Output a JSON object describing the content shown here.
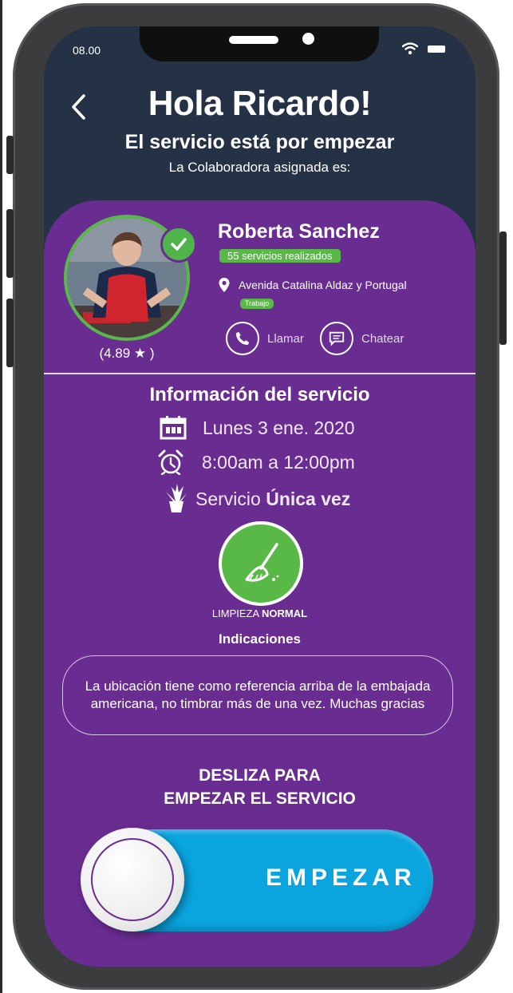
{
  "status_bar": {
    "time": "08.00"
  },
  "header": {
    "greeting": "Hola Ricardo!",
    "subtitle": "El servicio está por empezar",
    "assigned_text": "La Colaboradora asignada es:"
  },
  "collaborator": {
    "name": "Roberta Sanchez",
    "services_badge": "55 servicios realizados",
    "address": "Avenida Catalina Aldaz y Portugal",
    "address_tag": "Trabajo",
    "rating": "(4.89 ★ )",
    "call_label": "Llamar",
    "chat_label": "Chatear"
  },
  "service": {
    "section_title": "Información del servicio",
    "date": "Lunes 3 ene. 2020",
    "time": "8:00am a 12:00pm",
    "type_prefix": "Servicio ",
    "type_value": "Única vez",
    "cleaning_prefix": "LIMPIEZA ",
    "cleaning_value": "NORMAL",
    "indications_title": "Indicaciones",
    "indications_text": "La ubicación tiene como referencia arriba de la embajada americana, no timbrar más de una vez. Muchas gracias"
  },
  "slider": {
    "hint_line1": "DESLIZA PARA",
    "hint_line2": "EMPEZAR EL SERVICIO",
    "label": "EMPEZAR",
    "progress": 0
  },
  "colors": {
    "header_bg": "#253246",
    "card_bg": "#692c91",
    "accent_green": "#58b947",
    "slider_blue": "#0aa5df"
  },
  "icons": [
    "back-icon",
    "wifi-icon",
    "battery-icon",
    "check-icon",
    "location-icon",
    "phone-icon",
    "chat-icon",
    "calendar-icon",
    "alarm-clock-icon",
    "plant-icon",
    "broom-icon"
  ]
}
